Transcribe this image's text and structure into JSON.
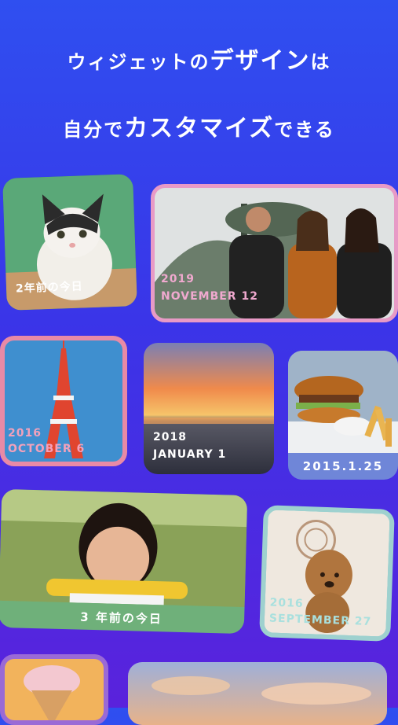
{
  "headline": {
    "line1_a": "ウィジェットの",
    "line1_b": "デザイン",
    "line1_c": "は",
    "line2_a": "自分で",
    "line2_b": "カスタマイズ",
    "line2_c": "できる"
  },
  "cards": {
    "cat": {
      "caption": "2年前の今日",
      "frame_color": "#3f8f5e"
    },
    "friends": {
      "year": "2019",
      "date": "NOVEMBER 12",
      "frame_color": "#e89ac6"
    },
    "tower": {
      "year": "2016",
      "date": "OCTOBER 6",
      "frame_color": "#e88aa6"
    },
    "sunset": {
      "year": "2018",
      "date": "JANUARY 1"
    },
    "burger": {
      "caption": "2015.1.25",
      "frame_color": "#6f86d8"
    },
    "girl": {
      "caption": "3 年前の今日",
      "frame_color": "#6fb07a"
    },
    "dog": {
      "year": "2016",
      "date": "SEPTEMBER 27",
      "frame_color": "#9ed1cf"
    }
  }
}
